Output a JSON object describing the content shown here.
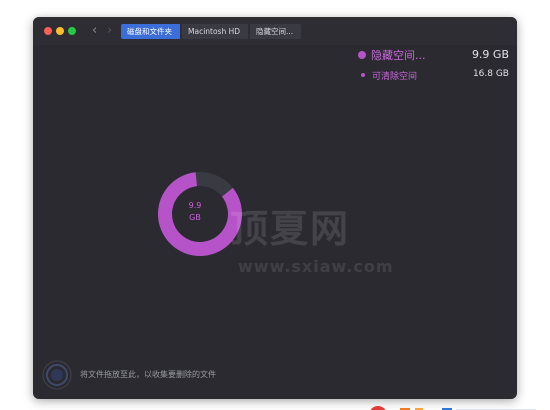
{
  "window": {
    "nav": {
      "back_icon": "‹",
      "forward_icon": "›"
    },
    "breadcrumbs": [
      {
        "label": "磁盘和文件夹",
        "active": true
      },
      {
        "label": "Macintosh HD",
        "active": false
      },
      {
        "label": "隐藏空间...",
        "active": false
      }
    ]
  },
  "legend": {
    "primary": {
      "label": "隐藏空间...",
      "value": "9.9 GB"
    },
    "secondary": {
      "label": "可清除空间",
      "value": "16.8 GB"
    }
  },
  "chart_data": {
    "type": "pie",
    "center_label_line1": "9.9",
    "center_label_line2": "GB",
    "slices": [
      {
        "name": "隐藏空间...",
        "value": 9.9,
        "color": "#b653c9"
      }
    ]
  },
  "watermark": {
    "text": "顶夏网",
    "url": "www.sxiaw.com"
  },
  "drop_hint": "将文件拖放至此，以收集要删除的文件",
  "colors": {
    "accent": "#b653c9",
    "breadcrumb_active": "#3b6ed8",
    "window_bg": "#2a2a30"
  }
}
